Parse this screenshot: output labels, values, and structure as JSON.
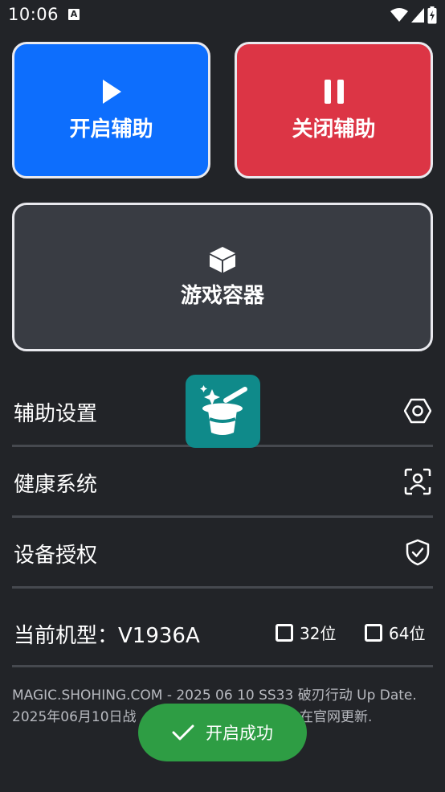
{
  "status_bar": {
    "time": "10:06",
    "notification_icon": "a-letter-icon",
    "icons": [
      "wifi-icon",
      "signal-icon",
      "battery-charging-icon"
    ]
  },
  "buttons": {
    "start": {
      "label": "开启辅助",
      "icon": "play-icon",
      "color": "#0d6efd"
    },
    "stop": {
      "label": "关闭辅助",
      "icon": "pause-icon",
      "color": "#dc3545"
    },
    "container": {
      "label": "游戏容器",
      "icon": "cube-icon",
      "color": "#393c43"
    }
  },
  "menu": [
    {
      "label": "辅助设置",
      "icon": "hexagon-settings-icon"
    },
    {
      "label": "健康系统",
      "icon": "face-scan-icon"
    },
    {
      "label": "设备授权",
      "icon": "shield-check-icon"
    }
  ],
  "model": {
    "label": "当前机型：V1936A",
    "options": [
      {
        "label": "32位",
        "checked": false
      },
      {
        "label": "64位",
        "checked": false
      }
    ]
  },
  "footer": {
    "line1": "MAGIC.SHOHING.COM - 2025 06 10 SS33 破刃行动 Up Date.",
    "line2_start": "2025年06月10日战",
    "line2_end": "在官网更新."
  },
  "overlay": {
    "icon": "magic-hat-icon",
    "color": "#0f8a8a"
  },
  "toast": {
    "text": "开启成功",
    "icon": "check-icon",
    "color": "#2e9d44"
  }
}
